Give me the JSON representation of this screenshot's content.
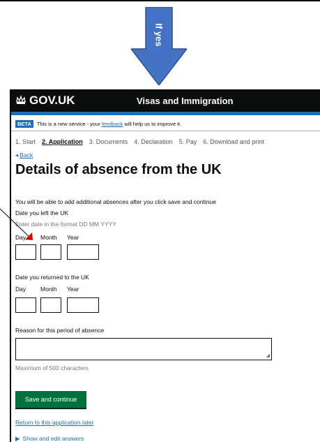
{
  "arrow": {
    "label": "If yes",
    "color": "#4472c4"
  },
  "header": {
    "logo": "GOV.UK",
    "service": "Visas and Immigration"
  },
  "beta": {
    "tag": "BETA",
    "text_before": "This is a new service - your ",
    "link": "feedback",
    "text_after": " will help us to improve it."
  },
  "steps": [
    {
      "label": "1. Start",
      "active": false
    },
    {
      "label": "2. Application",
      "active": true
    },
    {
      "label": "3. Documents",
      "active": false
    },
    {
      "label": "4. Declaration",
      "active": false
    },
    {
      "label": "5. Pay",
      "active": false
    },
    {
      "label": "6. Download and print",
      "active": false
    }
  ],
  "back": {
    "label": "Back"
  },
  "page": {
    "title": "Details of absence from the UK",
    "intro": "You will be able to add additional absences after you click save and continue"
  },
  "left_date": {
    "label": "Date you left the UK",
    "hint": "Enter date in the format DD MM YYYY",
    "day": "Day",
    "month": "Month",
    "year": "Year",
    "day_value": "",
    "month_value": "",
    "year_value": ""
  },
  "returned_date": {
    "label": "Date you returned to the UK",
    "day": "Day",
    "month": "Month",
    "year": "Year",
    "day_value": "",
    "month_value": "",
    "year_value": ""
  },
  "reason": {
    "label": "Reason for this period of absence",
    "value": "",
    "hint": "Maximum of 500 characters"
  },
  "actions": {
    "save": "Save and continue",
    "return": "Return to this application later",
    "show_answers": "Show and edit answers"
  },
  "colors": {
    "header_bg": "#0b0c0c",
    "brand_blue": "#1d70b8",
    "button_green": "#00703c",
    "pointer_red": "#e00000"
  }
}
